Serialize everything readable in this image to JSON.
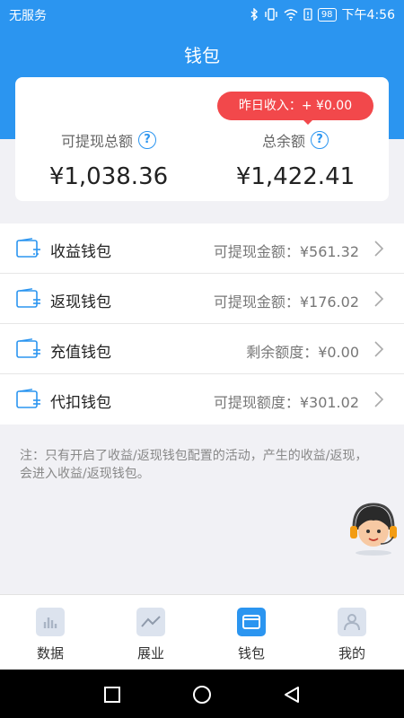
{
  "status": {
    "carrier": "无服务",
    "battery": "98",
    "time": "下午4:56"
  },
  "header": {
    "title": "钱包"
  },
  "summary": {
    "yesterday_income": "昨日收入：+ ¥0.00",
    "withdrawable_label": "可提现总额",
    "withdrawable_value": "¥1,038.36",
    "total_label": "总余额",
    "total_value": "¥1,422.41",
    "help_glyph": "?"
  },
  "wallets": [
    {
      "name": "收益钱包",
      "value": "可提现金额：¥561.32"
    },
    {
      "name": "返现钱包",
      "value": "可提现金额：¥176.02"
    },
    {
      "name": "充值钱包",
      "value": "剩余额度：¥0.00"
    },
    {
      "name": "代扣钱包",
      "value": "可提现额度：¥301.02"
    }
  ],
  "note": "注：只有开启了收益/返现钱包配置的活动，产生的收益/返现，会进入收益/返现钱包。",
  "tabs": [
    {
      "label": "数据",
      "icon": "bar-chart-icon",
      "active": false
    },
    {
      "label": "展业",
      "icon": "trend-line-icon",
      "active": false
    },
    {
      "label": "钱包",
      "icon": "wallet-icon",
      "active": true
    },
    {
      "label": "我的",
      "icon": "user-icon",
      "active": false
    }
  ],
  "colors": {
    "primary": "#2b95f0",
    "badge": "#f2484b",
    "background": "#f1f1f5"
  }
}
